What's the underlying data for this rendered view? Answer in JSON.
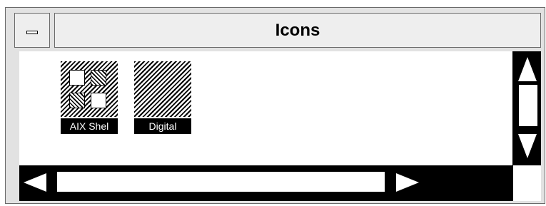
{
  "window": {
    "title": "Icons"
  },
  "icons": [
    {
      "label": "AIX Shel"
    },
    {
      "label": "Digital"
    }
  ]
}
